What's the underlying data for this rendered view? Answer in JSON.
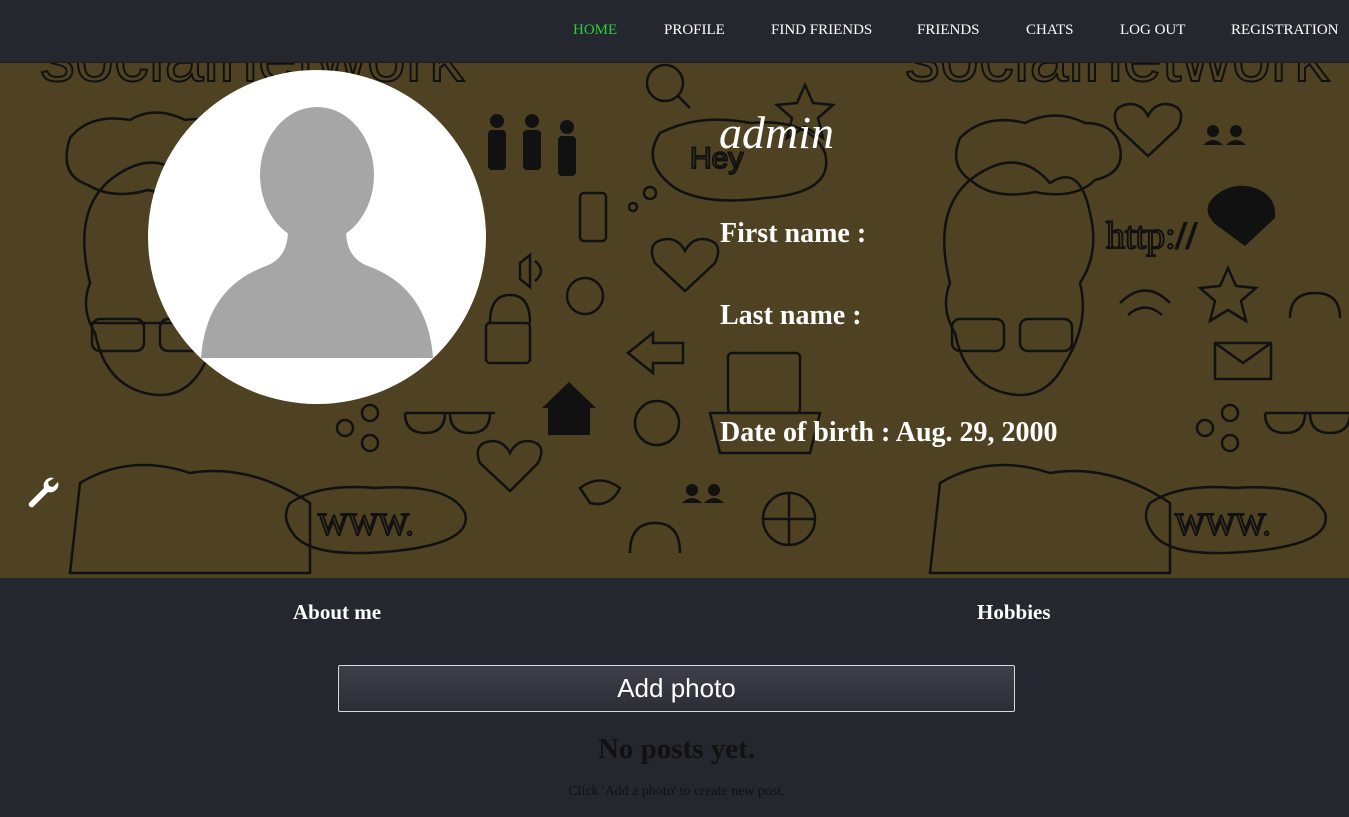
{
  "nav": {
    "items": [
      {
        "label": "HOME",
        "active": true
      },
      {
        "label": "PROFILE"
      },
      {
        "label": "FIND FRIENDS"
      },
      {
        "label": "FRIENDS"
      },
      {
        "label": "CHATS"
      },
      {
        "label": "LOG OUT"
      },
      {
        "label": "REGISTRATION"
      }
    ],
    "active_color": "#2ecc40"
  },
  "banner": {
    "background_color": "#4e4223",
    "background_text": "socialnetwork"
  },
  "profile": {
    "username": "admin",
    "first_name_label": "First name :",
    "last_name_label": "Last name :",
    "dob_label": "Date of birth : Aug. 29, 2000",
    "avatar_icon": "default-user-silhouette",
    "settings_icon": "wrench-icon"
  },
  "sections": {
    "about_label": "About me",
    "hobbies_label": "Hobbies"
  },
  "posts": {
    "add_photo_label": "Add photo",
    "empty_title": "No posts yet.",
    "empty_hint": "Click 'Add a photo' to create new post."
  },
  "colors": {
    "page_background": "#24272d",
    "text": "#ffffff"
  }
}
